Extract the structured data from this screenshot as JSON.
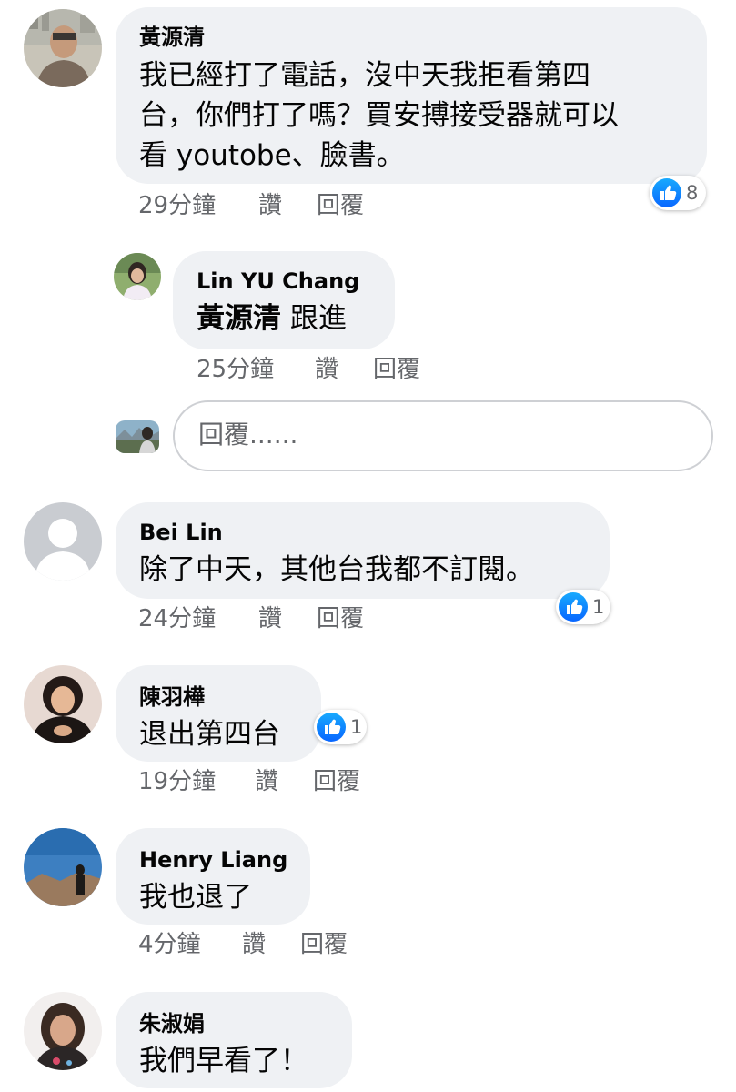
{
  "comments": [
    {
      "author": "黃源清",
      "lines": [
        "我已經打了電話，沒中天我拒看第四",
        "台，你們打了嗎？買安搏接受器就可以",
        "看 youtobe、臉書。"
      ],
      "time": "29分鐘",
      "like_label": "讚",
      "reply_label": "回覆",
      "reactions": "8"
    },
    {
      "author": "Lin YU  Chang",
      "tag": "黃源清",
      "text": "跟進",
      "time": "25分鐘",
      "like_label": "讚",
      "reply_label": "回覆"
    },
    {
      "author": "Bei Lin",
      "text": "除了中天，其他台我都不訂閱。",
      "time": "24分鐘",
      "like_label": "讚",
      "reply_label": "回覆",
      "reactions": "1"
    },
    {
      "author": "陳羽樺",
      "text": "退出第四台",
      "time": "19分鐘",
      "like_label": "讚",
      "reply_label": "回覆",
      "reactions": "1"
    },
    {
      "author": "Henry Liang",
      "text": "我也退了",
      "time": "4分鐘",
      "like_label": "讚",
      "reply_label": "回覆"
    },
    {
      "author": "朱淑娟",
      "text": "我們早看了！"
    }
  ],
  "reply_box": {
    "placeholder": "回覆......"
  },
  "icons": {
    "reaction": "like-icon",
    "default_avatar": "person-silhouette-icon"
  },
  "colors": {
    "bubble": "#eff1f4",
    "meta": "#65676b",
    "like_blue": "#0866ff"
  }
}
